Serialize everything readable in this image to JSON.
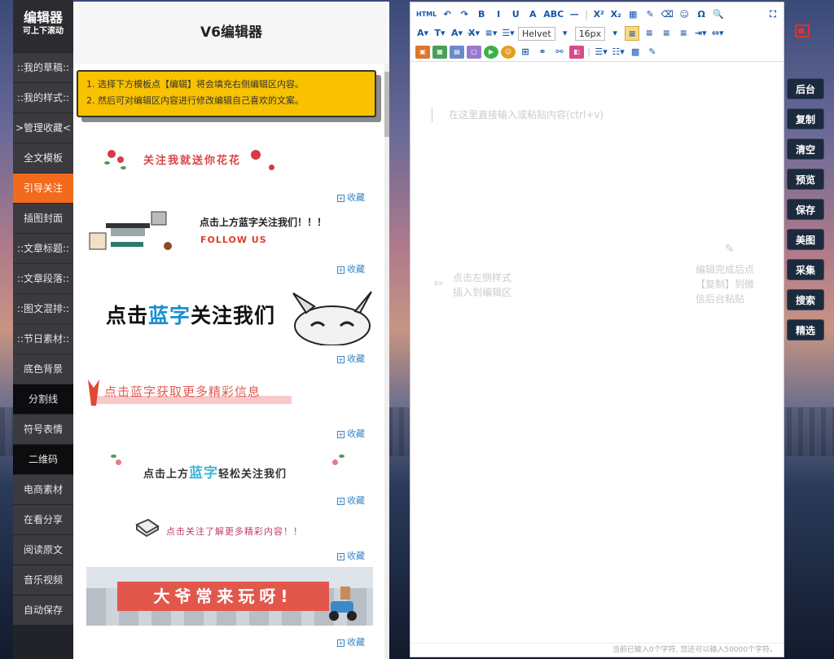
{
  "left_nav": {
    "title": "编辑器",
    "subtitle": "可上下滚动",
    "items": [
      {
        "label": "::我的草稿::",
        "state": "normal"
      },
      {
        "label": "::我的样式::",
        "state": "normal"
      },
      {
        "label": ">管理收藏<",
        "state": "normal"
      },
      {
        "label": "全文模板",
        "state": "normal"
      },
      {
        "label": "引导关注",
        "state": "active"
      },
      {
        "label": "插图封面",
        "state": "normal"
      },
      {
        "label": "::文章标题::",
        "state": "normal"
      },
      {
        "label": "::文章段落::",
        "state": "normal"
      },
      {
        "label": "::图文混排::",
        "state": "normal"
      },
      {
        "label": "::节日素材::",
        "state": "normal"
      },
      {
        "label": "底色背景",
        "state": "normal"
      },
      {
        "label": "分割线",
        "state": "dark"
      },
      {
        "label": "符号表情",
        "state": "normal"
      },
      {
        "label": "二维码",
        "state": "dark"
      },
      {
        "label": "电商素材",
        "state": "normal"
      },
      {
        "label": "在看分享",
        "state": "normal"
      },
      {
        "label": "阅读原文",
        "state": "normal"
      },
      {
        "label": "音乐视频",
        "state": "normal"
      },
      {
        "label": "自动保存",
        "state": "normal"
      }
    ]
  },
  "template_panel": {
    "title": "V6编辑器",
    "notice_line1": "1. 选择下方模板点【编辑】将会填充右侧编辑区内容。",
    "notice_line2": "2. 然后可对编辑区内容进行修改编辑自己喜欢的文案。",
    "collect_label": "收藏",
    "templates": {
      "t1": "关注我就送你花花",
      "t2_main": "点击上方蓝字关注我们！！！",
      "t2_follow": "FOLLOW US",
      "t3_a": "点击",
      "t3_b": "蓝字",
      "t3_c": "关注我们",
      "t4": "点击蓝字获取更多精彩信息",
      "t5_a": "点击上方",
      "t5_b": "蓝字",
      "t5_c": "轻松关注我们",
      "t6": "点击关注了解更多精彩内容！！",
      "t7": "大爷常来玩呀!"
    }
  },
  "editor": {
    "toolbar": {
      "row1": [
        "HTML",
        "↶",
        "↷",
        "B",
        "I",
        "U",
        "A",
        "ABC",
        "—",
        "|",
        "X²",
        "X₂",
        "▦",
        "✎",
        "⌫",
        "☺",
        "Ω",
        "🔍"
      ],
      "font_family": "Helvet",
      "font_size": "16px"
    },
    "placeholder": "在这里直接输入或粘贴内容(ctrl+v)",
    "hint_left_line1": "点击左侧样式",
    "hint_left_line2": "插入到编辑区",
    "hint_right_line1": "编辑完成后点",
    "hint_right_line2": "【复制】到微",
    "hint_right_line3": "信后台粘贴",
    "status": "当前已输入0个字符, 您还可以输入50000个字符。"
  },
  "right_actions": [
    "后台",
    "复制",
    "清空",
    "预览",
    "保存",
    "美图",
    "采集",
    "搜索",
    "精选"
  ],
  "colors": {
    "accent": "#f26a1b",
    "notice_bg": "#f8c200",
    "link_blue": "#3a84c7",
    "action_bg": "#1c2a3e"
  }
}
